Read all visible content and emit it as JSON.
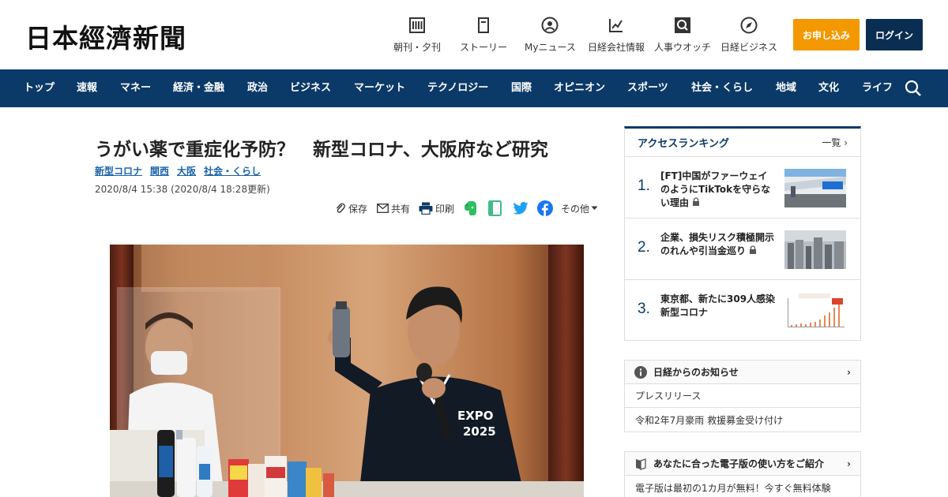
{
  "header": {
    "logo": "日本經濟新聞",
    "nav": [
      {
        "label": "朝刊・夕刊",
        "icon": "newspaper-icon"
      },
      {
        "label": "ストーリー",
        "icon": "story-icon"
      },
      {
        "label": "Myニュース",
        "icon": "user-icon"
      },
      {
        "label": "日経会社情報",
        "icon": "chart-icon"
      },
      {
        "label": "人事ウオッチ",
        "icon": "person-search-icon"
      },
      {
        "label": "日経ビジネス",
        "icon": "compass-icon"
      }
    ],
    "apply_label": "お申し込み",
    "login_label": "ログイン"
  },
  "navbar": {
    "items": [
      "トップ",
      "速報",
      "マネー",
      "経済・金融",
      "政治",
      "ビジネス",
      "マーケット",
      "テクノロジー",
      "国際",
      "オピニオン",
      "スポーツ",
      "社会・くらし",
      "地域",
      "文化",
      "ライフ"
    ]
  },
  "article": {
    "title": "うがい薬で重症化予防？　新型コロナ、大阪府など研究",
    "tags": [
      "新型コロナ",
      "関西",
      "大阪",
      "社会・くらし"
    ],
    "date": "2020/8/4 15:38 (2020/8/4 18:28更新)",
    "share": {
      "save": "保存",
      "share": "共有",
      "print": "印刷",
      "more": "その他"
    }
  },
  "sidebar": {
    "ranking": {
      "title": "アクセスランキング",
      "more": "一覧",
      "items": [
        {
          "rank": "1.",
          "text": "[FT]中国がファーウェイのようにTikTokを守らない理由"
        },
        {
          "rank": "2.",
          "text": "企業、損失リスク積極開示　のれんや引当金巡り"
        },
        {
          "rank": "3.",
          "text": "東京都、新たに309人感染　新型コロナ"
        }
      ]
    },
    "notice": {
      "title": "日経からのお知らせ",
      "rows": [
        "プレスリリース",
        "令和2年7月豪雨 救援募金受け付け"
      ]
    },
    "guide": {
      "title": "あなたに合った電子版の使い方をご紹介",
      "row": "電子版は最初の1カ月が無料！今すぐ無料体験"
    }
  },
  "colors": {
    "brand_navy": "#0b3a68",
    "apply_orange": "#f39800",
    "login_navy": "#0a2d52",
    "tag_blue": "#1a63a8"
  }
}
